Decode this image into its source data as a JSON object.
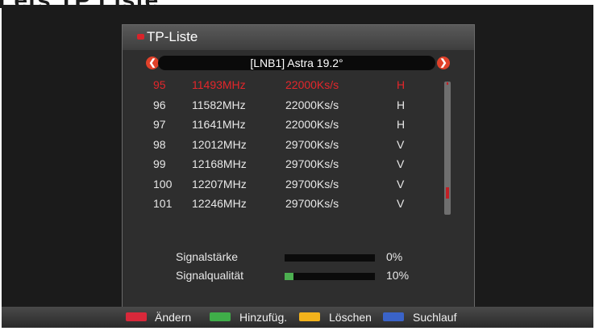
{
  "page_heading": "Lets TP Liste",
  "panel": {
    "title": "TP-Liste"
  },
  "selector": {
    "label": "[LNB1] Astra 19.2°"
  },
  "transponders": [
    {
      "no": "95",
      "freq": "11493MHz",
      "sr": "22000Ks/s",
      "pol": "H"
    },
    {
      "no": "96",
      "freq": "11582MHz",
      "sr": "22000Ks/s",
      "pol": "H"
    },
    {
      "no": "97",
      "freq": "11641MHz",
      "sr": "22000Ks/s",
      "pol": "H"
    },
    {
      "no": "98",
      "freq": "12012MHz",
      "sr": "29700Ks/s",
      "pol": "V"
    },
    {
      "no": "99",
      "freq": "12168MHz",
      "sr": "29700Ks/s",
      "pol": "V"
    },
    {
      "no": "100",
      "freq": "12207MHz",
      "sr": "29700Ks/s",
      "pol": "V"
    },
    {
      "no": "101",
      "freq": "12246MHz",
      "sr": "29700Ks/s",
      "pol": "V"
    }
  ],
  "signal": {
    "strength_label": "Signalstärke",
    "strength_value": "0%",
    "strength_level": 0,
    "quality_label": "Signalqualität",
    "quality_value": "10%",
    "quality_level": 0.1
  },
  "footer": {
    "red": "Ändern",
    "green": "Hinzufüg.",
    "yellow": "Löschen",
    "blue": "Suchlauf"
  },
  "colors": {
    "accent_red": "#e3262b",
    "key_red": "#d8283a",
    "key_green": "#3fae49",
    "key_yellow": "#f2b21b",
    "key_blue": "#3a63c8"
  }
}
